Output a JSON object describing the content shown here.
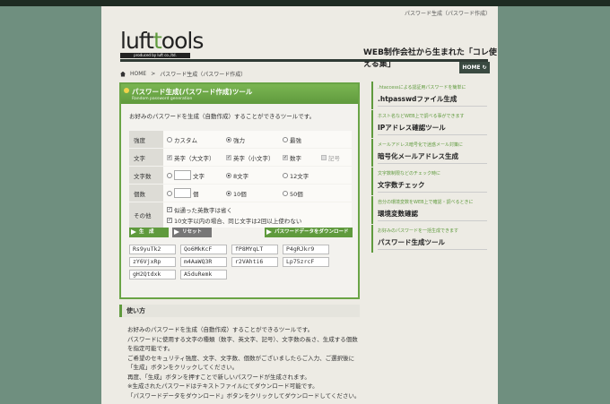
{
  "header": {
    "top_caption": "パスワード生成（パスワード作成）",
    "logo_main": "luft",
    "logo_accent": "t",
    "logo_end": "ools",
    "logo_sub": "produced by luft co.,ltd.",
    "tagline": "WEB制作会社から生まれた「コレ使える集」",
    "home_button": "HOME"
  },
  "breadcrumb": {
    "home": "HOME",
    "sep": ">",
    "current": "パスワード生成（パスワード作成）"
  },
  "tool": {
    "title": "パスワード生成(パスワード作成)ツール",
    "subtitle": "Random password generation",
    "intro": "お好みのパスワードを生成（自動作成）することができるツールです。",
    "rows": {
      "strength": {
        "label": "強度",
        "options": [
          "カスタム",
          "強力",
          "最強"
        ]
      },
      "chars": {
        "label": "文字",
        "options": [
          "英字（大文字）",
          "英字（小文字）",
          "数字",
          "記号"
        ]
      },
      "length": {
        "label": "文字数",
        "options": [
          "文字",
          "8文字",
          "12文字"
        ]
      },
      "count": {
        "label": "個数",
        "options": [
          "個",
          "10個",
          "50個"
        ]
      },
      "other": {
        "label": "その他",
        "options": [
          "似通った英数字は省く",
          "10文字以内の場合、同じ文字は2回以上使わない"
        ]
      }
    },
    "buttons": {
      "generate": "生　成",
      "reset": "リセット",
      "download": "パスワードデータをダウンロード"
    },
    "passwords": [
      "Rs9yuTk2",
      "Qo6MkKcF",
      "fP8MYqLT",
      "P4gRJkr9",
      "zY6VjxRp",
      "m4AaWQ3R",
      "r2VAhti6",
      "Lp75zrcF",
      "gH2Qtdxk",
      "A5duRemk"
    ]
  },
  "usage": {
    "title": "使い方",
    "lines": [
      "お好みのパスワードを生成（自動作成）することができるツールです。",
      "パスワードに使用する文字の種類（数字、英文字、記号）、文字数の長さ、生成する個数",
      "を指定可能です。",
      "ご希望のセキュリティ強度、文字、文字数、個数がございましたらご入力、ご選択後に",
      "「生成」ボタンをクリックしてください。",
      "再度、「生成」ボタンを押すことで新しいパスワードが生成されます。",
      "※生成されたパスワードはテキストファイルにてダウンロード可能です。",
      "「パスワードデータをダウンロード」ボタンをクリックしてダウンロードしてください。"
    ]
  },
  "sidebar": [
    {
      "sub": ".htaccessによる認証用パスワードを簡単に",
      "title": ".htpasswdファイル生成"
    },
    {
      "sub": "ホスト名などWEB上で調べる事ができます",
      "title": "IPアドレス確認ツール"
    },
    {
      "sub": "メールアドレス暗号化で迷惑メール対策に",
      "title": "暗号化メールアドレス生成"
    },
    {
      "sub": "文字数制限などのチェック時に",
      "title": "文字数チェック"
    },
    {
      "sub": "自分の環境変数をWEB上で確認・調べるときに",
      "title": "環境変数確認"
    },
    {
      "sub": "お好みのパスワードを一括生成できます",
      "title": "パスワード生成ツール"
    }
  ]
}
